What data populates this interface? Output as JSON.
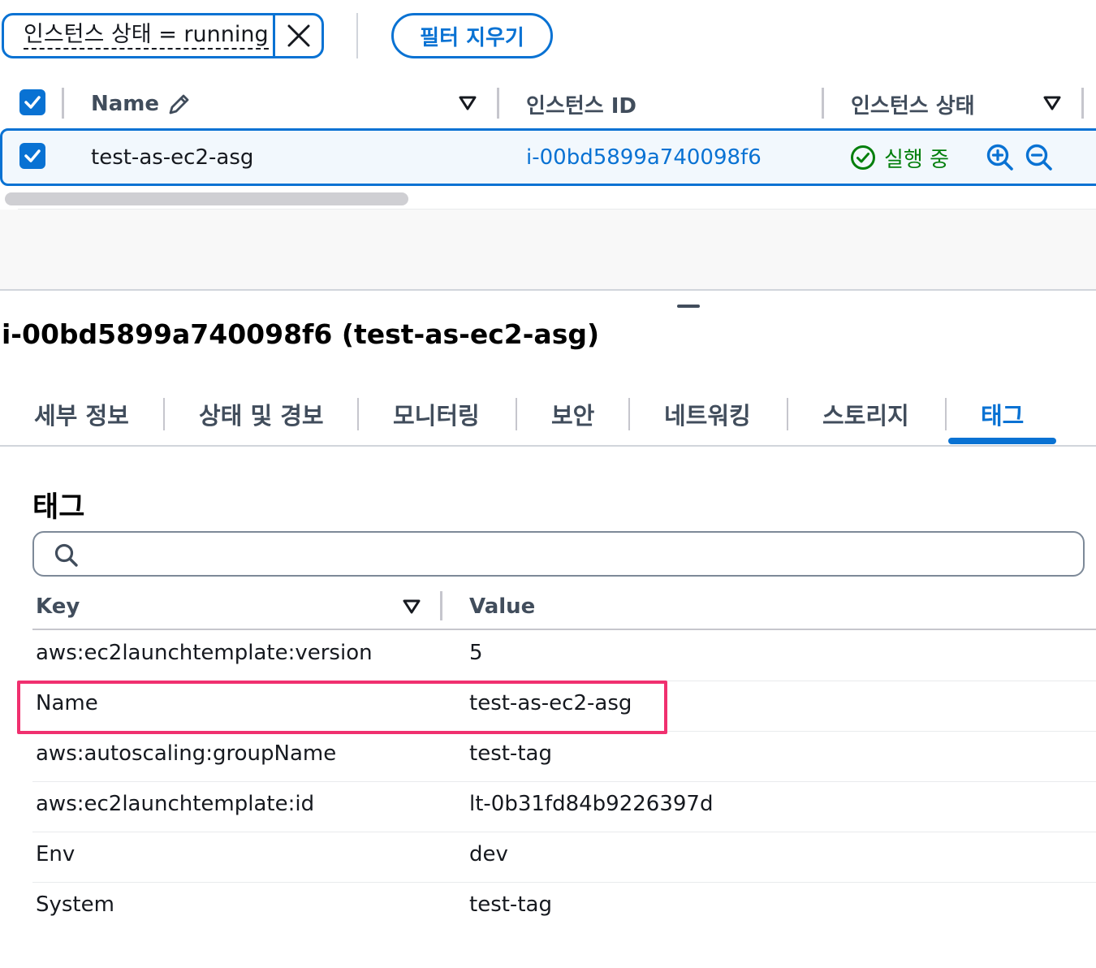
{
  "filter": {
    "token_label": "인스턴스 상태 = running",
    "clear_label": "필터 지우기"
  },
  "instances_table": {
    "columns": {
      "name": "Name",
      "instance_id": "인스턴스 ID",
      "instance_state": "인스턴스 상태"
    },
    "rows": [
      {
        "name": "test-as-ec2-asg",
        "instance_id": "i-00bd5899a740098f6",
        "state": "실행 중"
      }
    ]
  },
  "details": {
    "title": "i-00bd5899a740098f6 (test-as-ec2-asg)",
    "tabs": [
      "세부 정보",
      "상태 및 경보",
      "모니터링",
      "보안",
      "네트워킹",
      "스토리지",
      "태그"
    ],
    "active_tab": "태그"
  },
  "tags": {
    "section_title": "태그",
    "search_placeholder": "",
    "columns": {
      "key": "Key",
      "value": "Value"
    },
    "rows": [
      {
        "key": "aws:ec2launchtemplate:version",
        "value": "5"
      },
      {
        "key": "Name",
        "value": "test-as-ec2-asg"
      },
      {
        "key": "aws:autoscaling:groupName",
        "value": "test-tag"
      },
      {
        "key": "aws:ec2launchtemplate:id",
        "value": "lt-0b31fd84b9226397d"
      },
      {
        "key": "Env",
        "value": "dev"
      },
      {
        "key": "System",
        "value": "test-tag"
      }
    ],
    "highlighted_row_key": "Name"
  },
  "colors": {
    "accent": "#0972d3",
    "success": "#037f0c",
    "highlight": "#f0306f"
  }
}
